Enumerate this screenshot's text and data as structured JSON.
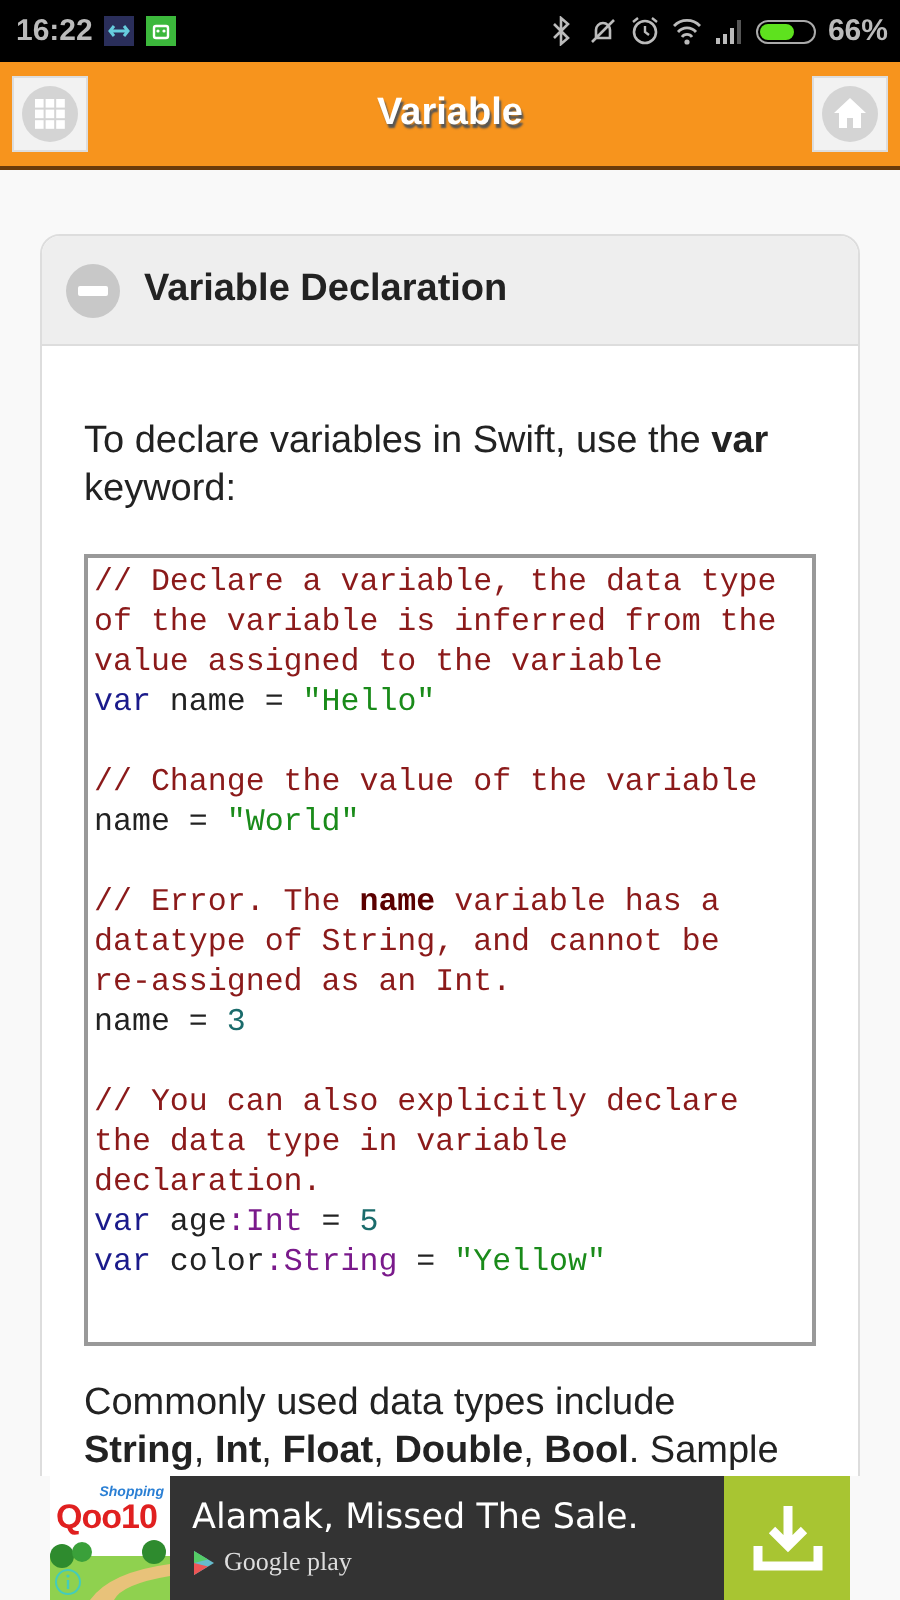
{
  "status_bar": {
    "time": "16:22",
    "battery_text": "66%",
    "battery": {
      "level": 0.66
    }
  },
  "header": {
    "title": "Variable"
  },
  "section": {
    "title": "Variable Declaration",
    "expanded": true,
    "intro": "To declare variables in Swift, use the **var** keyword:",
    "code_blocks": [
      {
        "lines": [
          [
            {
              "kind": "comment",
              "text": "// Declare a variable, the data type"
            }
          ],
          [
            {
              "kind": "comment",
              "text": "of the variable is inferred from the"
            }
          ],
          [
            {
              "kind": "comment",
              "text": "value assigned to the variable"
            }
          ],
          [
            {
              "kind": "keyword",
              "text": "var"
            },
            {
              "kind": "plain",
              "text": " name = "
            },
            {
              "kind": "string",
              "text": "\"Hello\""
            }
          ]
        ]
      },
      {
        "lines": [
          [
            {
              "kind": "comment",
              "text": "// Change the value of the variable"
            }
          ],
          [
            {
              "kind": "plain",
              "text": "name = "
            },
            {
              "kind": "string",
              "text": "\"World\""
            }
          ]
        ]
      },
      {
        "lines": [
          [
            {
              "kind": "comment",
              "text": "// Error. The "
            },
            {
              "kind": "comment_bold",
              "text": "name"
            },
            {
              "kind": "comment",
              "text": " variable has a"
            }
          ],
          [
            {
              "kind": "comment",
              "text": "datatype of String, and cannot be"
            }
          ],
          [
            {
              "kind": "comment",
              "text": "re-assigned as an Int."
            }
          ],
          [
            {
              "kind": "plain",
              "text": "name = "
            },
            {
              "kind": "number",
              "text": "3"
            }
          ]
        ]
      },
      {
        "lines": [
          [
            {
              "kind": "comment",
              "text": "// You can also explicitly declare"
            }
          ],
          [
            {
              "kind": "comment",
              "text": "the data type in variable"
            }
          ],
          [
            {
              "kind": "comment",
              "text": "declaration."
            }
          ],
          [
            {
              "kind": "keyword",
              "text": "var"
            },
            {
              "kind": "plain",
              "text": " age"
            },
            {
              "kind": "type",
              "text": ":Int"
            },
            {
              "kind": "plain",
              "text": " = "
            },
            {
              "kind": "number",
              "text": "5"
            }
          ],
          [
            {
              "kind": "keyword",
              "text": "var"
            },
            {
              "kind": "plain",
              "text": " color"
            },
            {
              "kind": "type",
              "text": ":String"
            },
            {
              "kind": "plain",
              "text": " = "
            },
            {
              "kind": "string",
              "text": "\"Yellow\""
            }
          ]
        ]
      }
    ],
    "outro": "Commonly used data types include **String**, **Int**, **Float**, **Double**, **Bool**. Sample"
  },
  "ad": {
    "logo_small": "Shopping",
    "logo": "Qoo10",
    "headline": "Alamak, Missed The Sale.",
    "store": "Google play"
  }
}
